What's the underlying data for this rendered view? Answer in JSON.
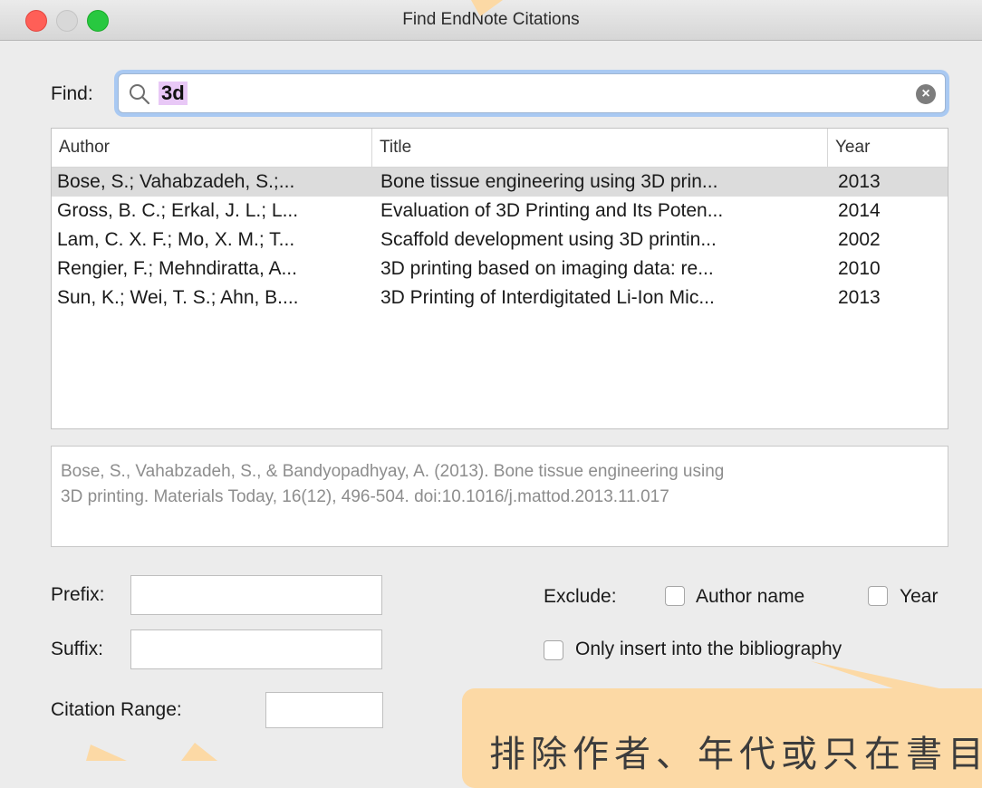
{
  "window": {
    "title": "Find EndNote Citations"
  },
  "find": {
    "label": "Find:",
    "query": "3d",
    "search_icon": "search-icon",
    "clear_icon": "clear-icon"
  },
  "table": {
    "columns": [
      "Author",
      "Title",
      "Year"
    ],
    "rows": [
      {
        "author": "Bose, S.; Vahabzadeh, S.;...",
        "title": "Bone tissue engineering using 3D prin...",
        "year": "2013"
      },
      {
        "author": "Gross, B. C.; Erkal, J. L.; L...",
        "title": "Evaluation of 3D Printing and Its Poten...",
        "year": "2014"
      },
      {
        "author": "Lam, C. X. F.; Mo, X. M.; T...",
        "title": "Scaffold development using 3D printin...",
        "year": "2002"
      },
      {
        "author": "Rengier, F.; Mehndiratta, A...",
        "title": "3D printing based on imaging data: re...",
        "year": "2010"
      },
      {
        "author": "Sun, K.; Wei, T. S.; Ahn, B....",
        "title": "3D Printing of Interdigitated Li-Ion Mic...",
        "year": "2013"
      }
    ]
  },
  "preview": {
    "line1": "Bose, S., Vahabzadeh, S., & Bandyopadhyay, A. (2013). Bone tissue engineering using",
    "line2": "3D printing. Materials Today, 16(12), 496-504. doi:10.1016/j.mattod.2013.11.017"
  },
  "options": {
    "prefix_label": "Prefix:",
    "suffix_label": "Suffix:",
    "range_label": "Citation Range:",
    "exclude_label": "Exclude:",
    "author_name_label": "Author name",
    "year_label": "Year",
    "bib_only_label": "Only insert into the bibliography"
  },
  "annotation": {
    "text": "排除作者、年代或只在書目"
  },
  "colors": {
    "selection": "#dcdcdc",
    "search_highlight": "#e8c8f6",
    "callout": "#fcd9a5",
    "focus_ring": "#a9c9f2"
  }
}
